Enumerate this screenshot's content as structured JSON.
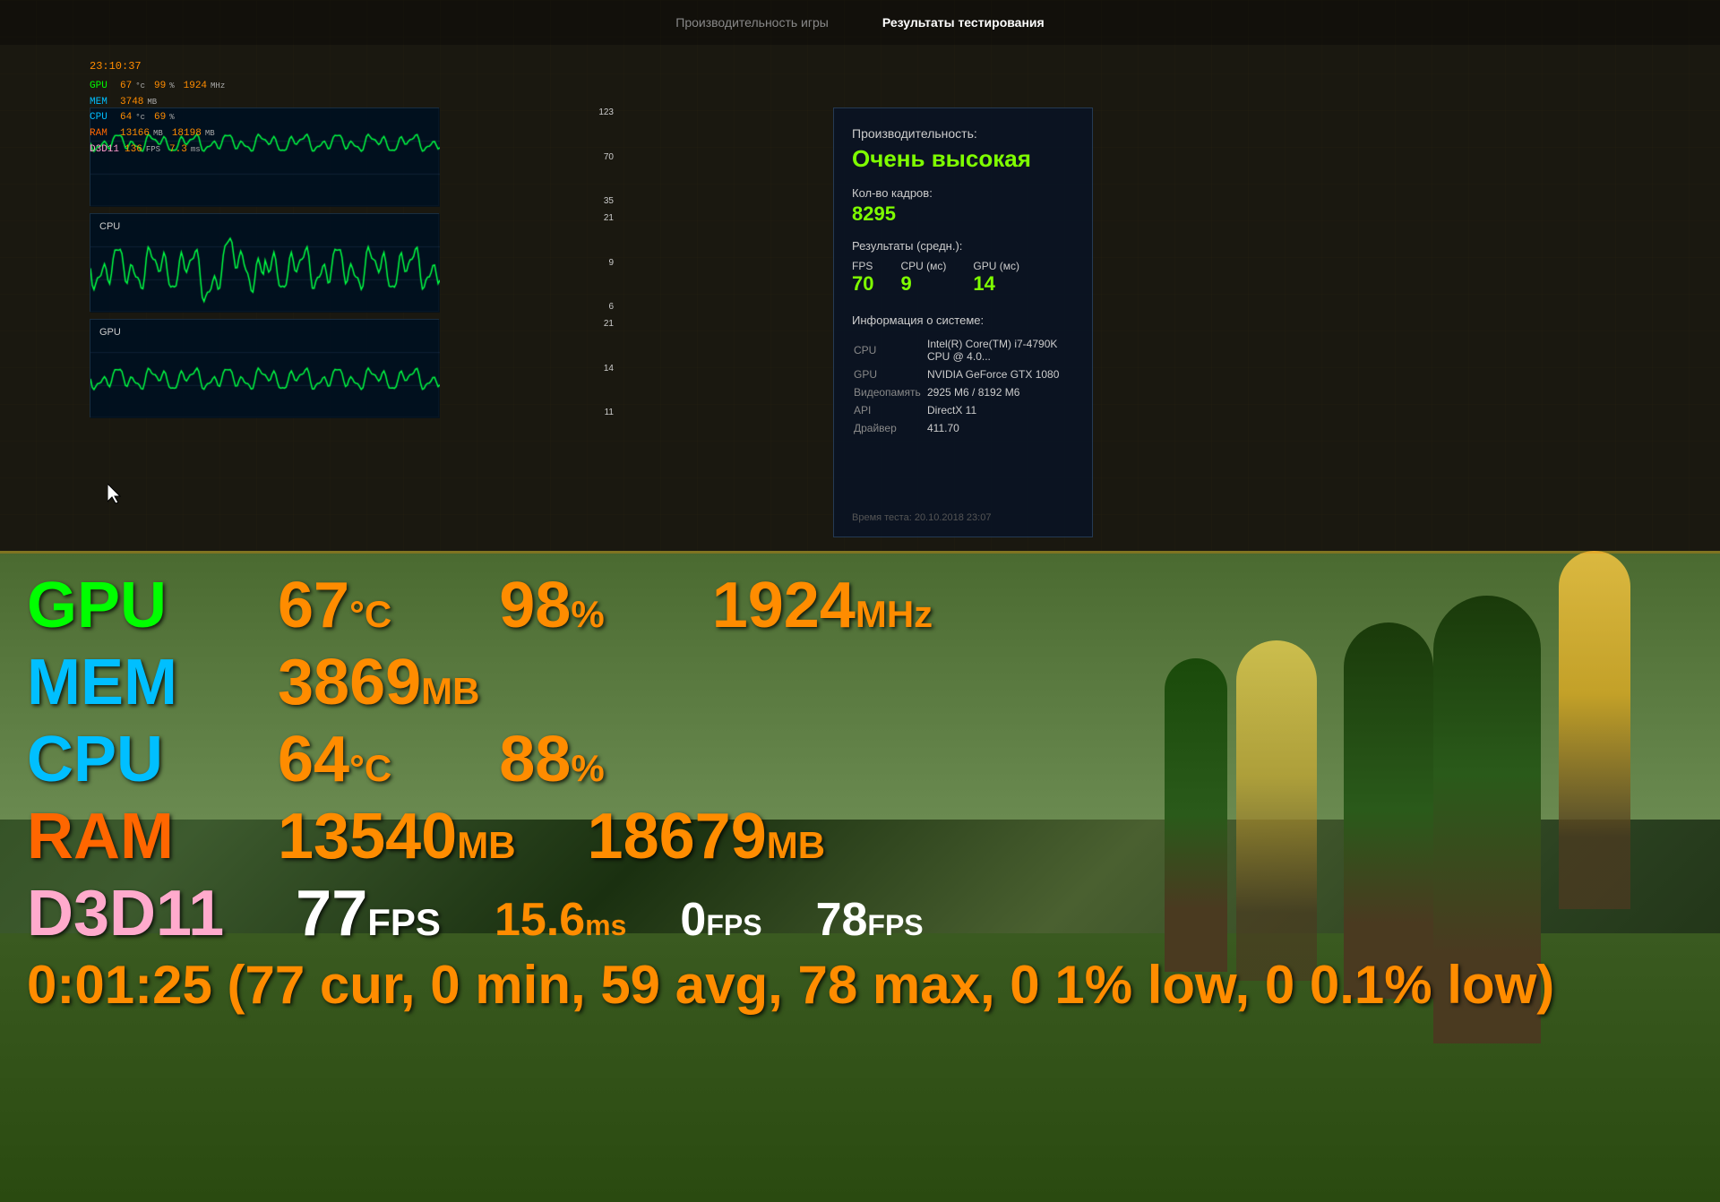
{
  "nav": {
    "tab1": "Производительность игры",
    "tab2": "Результаты тестирования"
  },
  "stats_overlay": {
    "time": "23:10:37",
    "gpu_label": "GPU",
    "gpu_temp": "67",
    "gpu_temp_unit": "°C",
    "gpu_load": "99",
    "gpu_load_unit": "%",
    "gpu_clock": "1924",
    "gpu_clock_unit": "MHz",
    "mem_label": "MEM",
    "mem_val": "3748",
    "mem_unit": "MB",
    "cpu_label": "CPU",
    "cpu_temp": "64",
    "cpu_temp_unit": "°C",
    "cpu_load": "69",
    "cpu_load_unit": "%",
    "ram_label": "RAM",
    "ram_val": "13166",
    "ram_unit": "MB",
    "ram_val2": "18198",
    "ram_unit2": "MB",
    "d3d_label": "D3D11",
    "d3d_fps": "136",
    "d3d_unit": "FPS",
    "d3d_ms": "7.3",
    "d3d_ms_unit": "ms"
  },
  "charts": {
    "chart1": {
      "label": "",
      "val_top": "123",
      "val_mid": "70",
      "val_bot": "35"
    },
    "chart2": {
      "label": "CPU",
      "val_top": "21",
      "val_mid": "9",
      "val_bot": "6"
    },
    "chart3": {
      "label": "GPU",
      "val_top": "21",
      "val_mid": "14",
      "val_bot": "11"
    }
  },
  "results": {
    "perf_label": "Производительность:",
    "perf_value": "Очень высокая",
    "frames_label": "Кол-во кадров:",
    "frames_value": "8295",
    "avg_label": "Результаты (средн.):",
    "fps_header": "FPS",
    "fps_value": "70",
    "cpu_header": "CPU (мс)",
    "cpu_value": "9",
    "gpu_header": "GPU (мс)",
    "gpu_value": "14",
    "sysinfo_label": "Информация о системе:",
    "cpu_label": "CPU",
    "cpu_info": "Intel(R) Core(TM) i7-4790K CPU @ 4.0...",
    "gpu_label": "GPU",
    "gpu_info": "NVIDIA GeForce GTX 1080",
    "vram_label": "Видеопамять",
    "vram_info": "2925 М6 / 8192 М6",
    "api_label": "API",
    "api_info": "DirectX 11",
    "driver_label": "Драйвер",
    "driver_info": "411.70",
    "timestamp": "Время теста: 20.10.2018 23:07"
  },
  "big_stats": {
    "gpu_label": "GPU",
    "gpu_temp": "67",
    "gpu_temp_unit": "°C",
    "gpu_load": "98",
    "gpu_load_unit": "%",
    "gpu_clock": "1924",
    "gpu_clock_unit": "MHz",
    "mem_label": "MEM",
    "mem_val": "3869",
    "mem_unit": "MB",
    "cpu_label": "CPU",
    "cpu_temp": "64",
    "cpu_temp_unit": "°C",
    "cpu_load": "88",
    "cpu_load_unit": "%",
    "ram_label": "RAM",
    "ram_val": "13540",
    "ram_unit": "MB",
    "ram_val2": "18679",
    "ram_unit2": "MB",
    "d3d_label": "D3D11",
    "d3d_fps": "77",
    "d3d_fps_unit": "FPS",
    "d3d_ms": "15.6",
    "d3d_ms_unit": "ms",
    "d3d_zero": "0",
    "d3d_zero_unit": "FPS",
    "d3d_78": "78",
    "d3d_78_unit": "FPS",
    "timing": "0:01:25 (77 cur, 0 min, 59 avg, 78 max, 0 1% low, 0 0.1% low)"
  }
}
